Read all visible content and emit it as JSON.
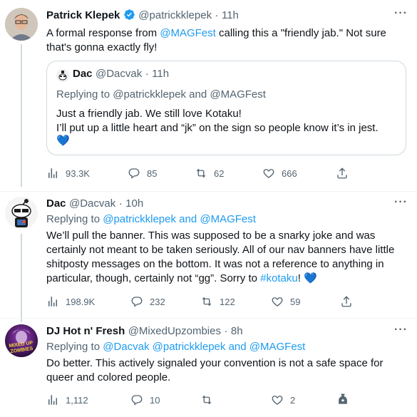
{
  "tweets": [
    {
      "name": "Patrick Klepek",
      "handle": "@patrickklepek",
      "dot": "·",
      "time": "11h",
      "text_a": "A formal response from ",
      "mention": "@MAGFest",
      "text_b": " calling this a \"friendly jab.\" Not sure that's gonna exactly fly!",
      "quote": {
        "name": "Dac",
        "handle": "@Dacvak",
        "dot": "·",
        "time": "11h",
        "replying_prefix": "Replying to ",
        "replying_targets": "@patrickklepek and @MAGFest",
        "line1": "Just a friendly jab. We still love Kotaku!",
        "line2": "I’ll put up a little heart and “jk” on the sign so people know it’s in jest.",
        "emoji": "💙"
      },
      "views": "93.3K",
      "replies": "85",
      "retweets": "62",
      "likes": "666"
    },
    {
      "name": "Dac",
      "handle": "@Dacvak",
      "dot": "·",
      "time": "10h",
      "replying_prefix": "Replying to ",
      "replying_targets": "@patrickklepek and @MAGFest",
      "text": "We’ll pull the banner. This was supposed to be a snarky joke and was certainly not meant to be taken seriously. All of our nav banners have little shitposty messages on the bottom. It was not a reference to anything in particular, though, certainly not “gg”. Sorry to ",
      "hashtag": "#kotaku",
      "text_end": "! ",
      "emoji": "💙",
      "views": "198.9K",
      "replies": "232",
      "retweets": "122",
      "likes": "59"
    },
    {
      "name": "DJ Hot n' Fresh",
      "handle": "@MixedUpzombies",
      "dot": "·",
      "time": "8h",
      "replying_prefix": "Replying to ",
      "replying_targets": "@Dacvak @patrickklepek and @MAGFest",
      "text": "Do better. This actively signaled your convention is not a safe space for queer and colored people.",
      "avatar_text": "MIXED UP ZOMBIES",
      "views": "1,112",
      "replies": "10",
      "retweets": "",
      "likes": "2"
    }
  ],
  "more_icon": "···",
  "colors": {
    "link": "#1d9bf0",
    "muted": "#536471",
    "divider": "#eff3f4"
  }
}
